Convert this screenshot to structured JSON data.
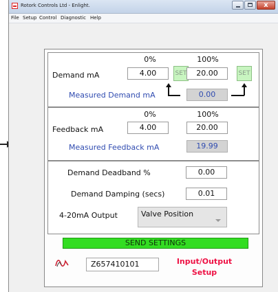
{
  "window": {
    "title": "Rotork Controls Ltd - Enlight.",
    "close_glyph": "x"
  },
  "menu": [
    "File",
    "Setup",
    "Control",
    "Diagnostic",
    "Help"
  ],
  "demand": {
    "pct_low": "0%",
    "pct_high": "100%",
    "label": "Demand mA",
    "low_value": "4.00",
    "high_value": "20.00",
    "set_label": "SET",
    "measured_label": "Measured Demand mA",
    "measured_value": "0.00"
  },
  "feedback": {
    "pct_low": "0%",
    "pct_high": "100%",
    "label": "Feedback mA",
    "low_value": "4.00",
    "high_value": "20.00",
    "measured_label": "Measured Feedback mA",
    "measured_value": "19.99"
  },
  "settings": {
    "deadband_label": "Demand Deadband %",
    "deadband_value": "0.00",
    "damping_label": "Demand Damping (secs)",
    "damping_value": "0.01",
    "output_label": "4-20mA Output",
    "output_value": "Valve Position"
  },
  "send_label": "SEND SETTINGS",
  "serial": "Z657410101",
  "io_label_line1": "Input/Output",
  "io_label_line2": "Setup",
  "colors": {
    "send_button": "#33dd22",
    "set_button": "#c8f5c0",
    "measured_text": "#2f4bb0",
    "io_label": "#ee1144"
  },
  "icons": {
    "app": "rotork-app-icon",
    "logo": "rotork-wave-logo",
    "set_arrows": "elbow-up-arrow-icon",
    "dropdown": "chevron-down-icon"
  }
}
